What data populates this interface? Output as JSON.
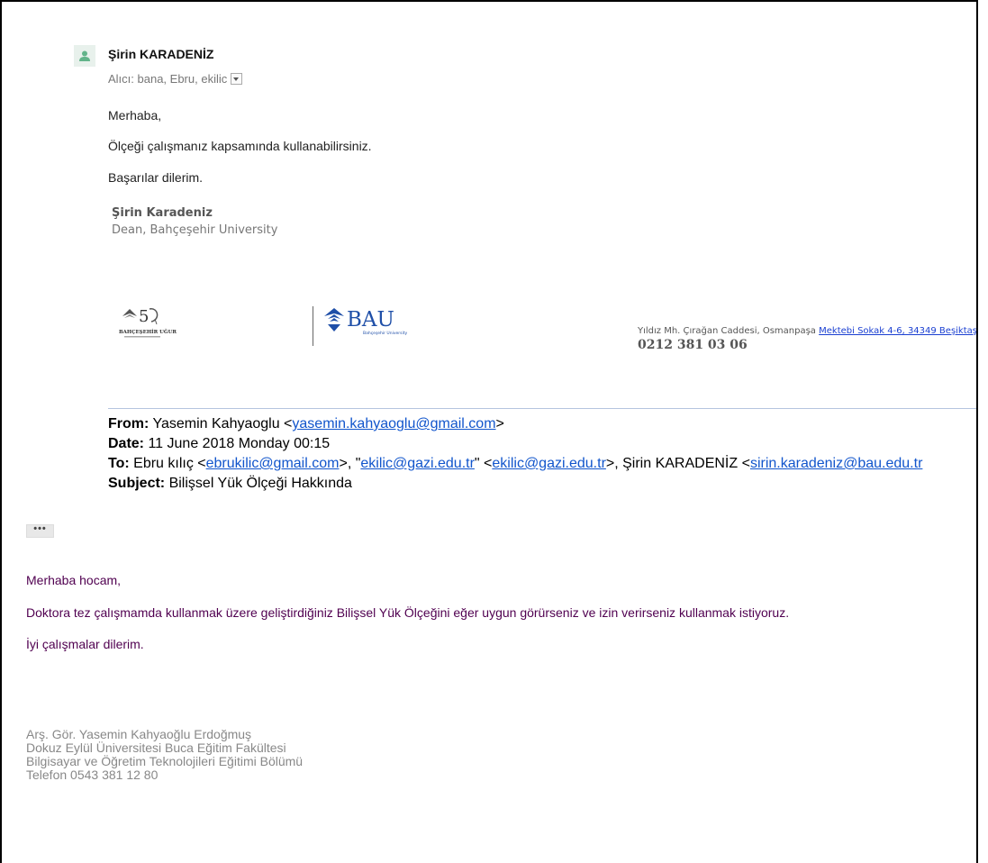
{
  "reply": {
    "sender_name": "Şirin KARADENİZ",
    "recipients": "Alıcı: bana, Ebru, ekilic",
    "greeting": "Merhaba,",
    "line1": "Ölçeği çalışmanız kapsamında kullanabilirsiniz.",
    "closing": "Başarılar dilerim.",
    "signature": {
      "name": "Şirin Karadeniz",
      "role": "Dean, Bahçeşehir University",
      "logo1_text": "BAHÇEŞEHİR UĞUR",
      "logo2_text": "BAU",
      "logo2_sub": "Bahçeşehir University",
      "address_prefix": "Yıldız Mh. Çırağan Caddesi, Osmanpaşa ",
      "address_link": "Mektebi Sokak 4-6, 34349 Beşiktaş",
      "phone": "0212 381 03 06"
    }
  },
  "forwarded": {
    "from_label": "From:",
    "from_name": "Yasemin Kahyaoglu <",
    "from_email": "yasemin.kahyaoglu@gmail.com",
    "from_end": ">",
    "date_label": "Date:",
    "date_value": "11 June 2018 Monday 00:15",
    "to_label": "To:",
    "to_part1": "Ebru kılıç <",
    "to_email1": "ebrukilic@gmail.com",
    "to_part2": ">, \"",
    "to_email2": "ekilic@gazi.edu.tr",
    "to_part3": "\" <",
    "to_email3": "ekilic@gazi.edu.tr",
    "to_part4": ">, Şirin KARADENİZ <",
    "to_email4": "sirin.karadeniz@bau.edu.tr",
    "subject_label": "Subject:",
    "subject_value": "Bilişsel Yük Ölçeği Hakkında"
  },
  "ellipsis_label": "•••",
  "original": {
    "greeting": "Merhaba hocam,",
    "body": "Doktora tez çalışmamda kullanmak üzere geliştirdiğiniz Bilişsel Yük Ölçeğini eğer uygun görürseniz ve izin verirseniz kullanmak istiyoruz.",
    "closing": "İyi çalışmalar dilerim.",
    "signature": [
      "Arş. Gör. Yasemin Kahyaoğlu Erdoğmuş",
      "Dokuz Eylül Üniversitesi Buca Eğitim Fakültesi",
      "Bilgisayar ve Öğretim Teknolojileri Eğitimi Bölümü",
      "Telefon 0543 381 12 80"
    ]
  },
  "colors": {
    "link": "#1155cc",
    "original_text": "#500050",
    "avatar_bg": "#e8f1ec",
    "avatar_fg": "#62b48a"
  },
  "icons": {
    "avatar": "person-icon",
    "recipients_toggle": "chevron-down-icon",
    "show_trimmed": "ellipsis-icon"
  }
}
